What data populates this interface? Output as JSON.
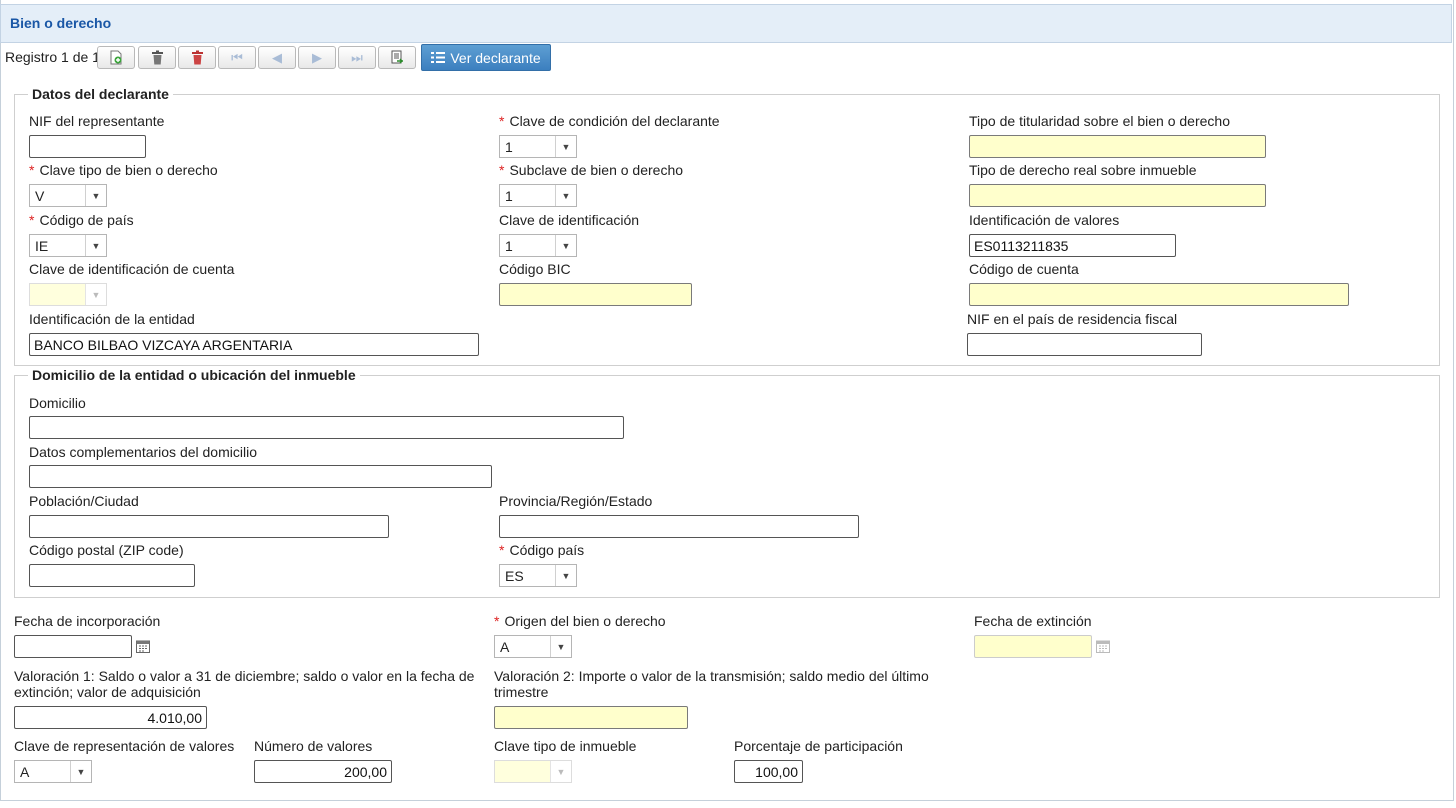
{
  "header": {
    "title": "Bien o derecho"
  },
  "toolbar": {
    "record_label": "Registro 1 de 1",
    "view_declarant_label": "Ver declarante"
  },
  "section_declarant": {
    "legend": "Datos del declarante",
    "nif_rep": {
      "label": "NIF del representante",
      "value": ""
    },
    "clave_condicion": {
      "label": "Clave de condición del declarante",
      "value": "1"
    },
    "tipo_titularidad": {
      "label": "Tipo de titularidad sobre el bien o derecho",
      "value": ""
    },
    "clave_tipo": {
      "label": "Clave tipo de bien o derecho",
      "value": "V"
    },
    "subclave": {
      "label": "Subclave de bien o derecho",
      "value": "1"
    },
    "tipo_derecho_real": {
      "label": "Tipo de derecho real sobre inmueble",
      "value": ""
    },
    "codigo_pais": {
      "label": "Código de país",
      "value": "IE"
    },
    "clave_identificacion": {
      "label": "Clave de identificación",
      "value": "1"
    },
    "identificacion_valores": {
      "label": "Identificación de valores",
      "value": "ES0113211835"
    },
    "clave_id_cuenta": {
      "label": "Clave de identificación de cuenta",
      "value": ""
    },
    "codigo_bic": {
      "label": "Código BIC",
      "value": ""
    },
    "codigo_cuenta": {
      "label": "Código de cuenta",
      "value": ""
    },
    "identificacion_entidad": {
      "label": "Identificación de la entidad",
      "value": "BANCO BILBAO VIZCAYA ARGENTARIA"
    },
    "nif_residencia": {
      "label": "NIF en el país de residencia fiscal",
      "value": ""
    }
  },
  "section_domicile": {
    "legend": "Domicilio de la entidad o ubicación del inmueble",
    "domicilio": {
      "label": "Domicilio",
      "value": ""
    },
    "datos_complementarios": {
      "label": "Datos complementarios del domicilio",
      "value": ""
    },
    "poblacion": {
      "label": "Población/Ciudad",
      "value": ""
    },
    "provincia": {
      "label": "Provincia/Región/Estado",
      "value": ""
    },
    "codigo_postal": {
      "label": "Código postal (ZIP code)",
      "value": ""
    },
    "codigo_pais": {
      "label": "Código país",
      "value": "ES"
    }
  },
  "bottom": {
    "fecha_incorporacion": {
      "label": "Fecha de incorporación",
      "value": ""
    },
    "origen": {
      "label": "Origen del bien o derecho",
      "value": "A"
    },
    "fecha_extincion": {
      "label": "Fecha de extinción",
      "value": ""
    },
    "valoracion1": {
      "label": "Valoración 1: Saldo o valor a 31 de diciembre; saldo o valor en la fecha de extinción; valor de adquisición",
      "value": "4.010,00"
    },
    "valoracion2": {
      "label": "Valoración 2: Importe o valor de la transmisión; saldo medio del último trimestre",
      "value": ""
    },
    "clave_representacion": {
      "label": "Clave de representación de valores",
      "value": "A"
    },
    "numero_valores": {
      "label": "Número de valores",
      "value": "200,00"
    },
    "clave_tipo_inmueble": {
      "label": "Clave tipo de inmueble",
      "value": ""
    },
    "porcentaje": {
      "label": "Porcentaje de participación",
      "value": "100,00"
    }
  },
  "icons": {
    "new": "add-record-icon",
    "delete": "trash-icon",
    "delete_all": "trash-red-icon",
    "first": "first-icon",
    "prev": "prev-icon",
    "next": "next-icon",
    "last": "last-icon",
    "export": "export-icon",
    "list": "list-icon",
    "calendar": "calendar-icon"
  },
  "colors": {
    "accent": "#3c7fbf",
    "header_bg": "#e4eef8",
    "title": "#1a57a6",
    "required": "#d22222",
    "readonly_bg": "#ffffcc"
  }
}
